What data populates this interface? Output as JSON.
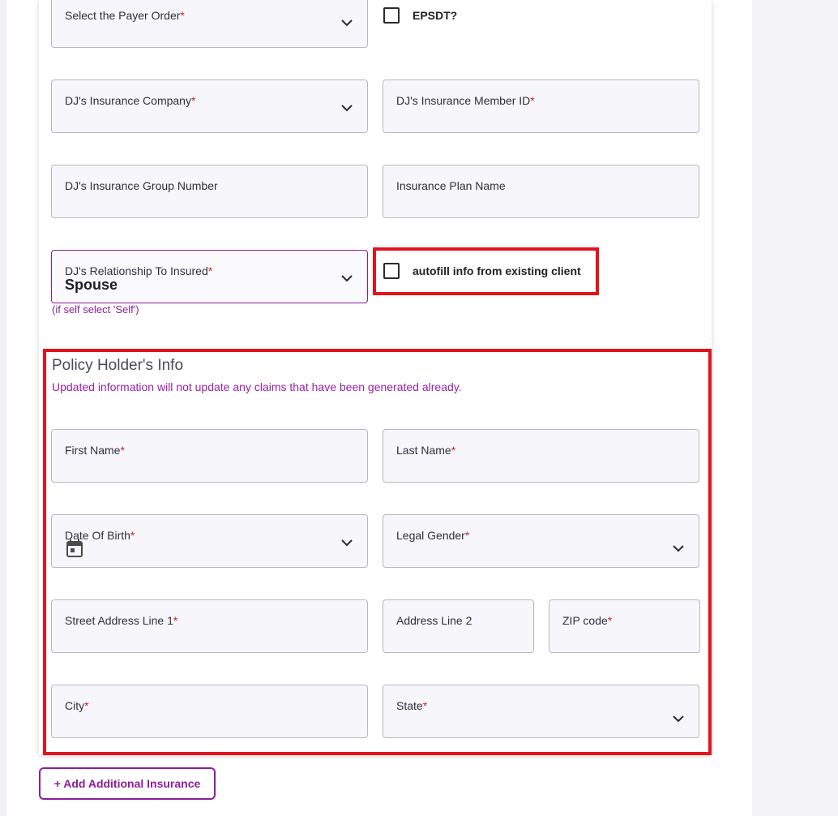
{
  "form": {
    "payer_order": {
      "label": "Select the Payer Order",
      "required": "*"
    },
    "epsdt": {
      "label": "EPSDT?"
    },
    "insurance_company": {
      "label": "DJ's Insurance Company",
      "required": "*"
    },
    "member_id": {
      "label": "DJ's Insurance Member ID",
      "required": "*"
    },
    "group_number": {
      "label": "DJ's Insurance Group Number"
    },
    "plan_name": {
      "label": "Insurance Plan Name"
    },
    "relationship": {
      "label": "DJ's Relationship To Insured",
      "required": "*",
      "value": "Spouse",
      "hint": "(if self select 'Self')"
    },
    "autofill": {
      "label": "autofill info from existing client"
    }
  },
  "policy_holder": {
    "title": "Policy Holder's Info",
    "notice": "Updated information will not update any claims that have been generated already.",
    "first_name": {
      "label": "First Name",
      "required": "*"
    },
    "last_name": {
      "label": "Last Name",
      "required": "*"
    },
    "dob": {
      "label": "Date Of Birth",
      "required": "*",
      "icon": "calendar-icon"
    },
    "gender": {
      "label": "Legal Gender",
      "required": "*"
    },
    "street1": {
      "label": "Street Address Line 1",
      "required": "*"
    },
    "address2": {
      "label": "Address Line 2"
    },
    "zip": {
      "label": "ZIP code",
      "required": "*"
    },
    "city": {
      "label": "City",
      "required": "*"
    },
    "state": {
      "label": "State",
      "required": "*"
    }
  },
  "actions": {
    "add_insurance": "+ Add Additional Insurance"
  },
  "colors": {
    "accent": "#8b1e9b",
    "required": "#d21f1f",
    "highlight": "#e3121f"
  }
}
